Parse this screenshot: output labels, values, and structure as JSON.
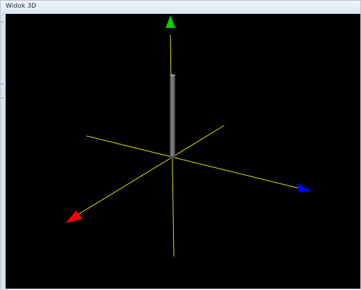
{
  "window": {
    "title": "Widok 3D"
  },
  "scene": {
    "background": "#000000",
    "grid_line_color": "#e6e600",
    "axis_arrows": [
      {
        "axis": "y",
        "color": "#00d000",
        "icon": "green-arrow-icon"
      },
      {
        "axis": "z",
        "color": "#0000ff",
        "icon": "blue-arrow-icon"
      },
      {
        "axis": "x",
        "color": "#ff0000",
        "icon": "red-arrow-icon"
      }
    ],
    "object": {
      "name": "cylinder",
      "color": "#6e6e6e"
    }
  }
}
